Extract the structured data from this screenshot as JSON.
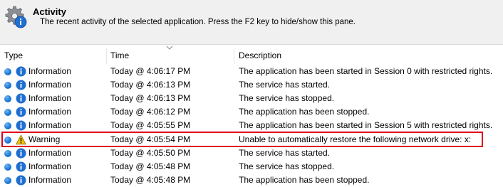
{
  "header": {
    "title": "Activity",
    "subtitle": "The recent activity of the selected application. Press the F2 key to hide/show this pane."
  },
  "columns": {
    "type": "Type",
    "time": "Time",
    "description": "Description"
  },
  "rows": [
    {
      "type": "Information",
      "time": "Today @ 4:06:17 PM",
      "description": "The application has been started in Session 0 with restricted rights.",
      "icon": "info-icon"
    },
    {
      "type": "Information",
      "time": "Today @ 4:06:13 PM",
      "description": "The service has started.",
      "icon": "info-icon"
    },
    {
      "type": "Information",
      "time": "Today @ 4:06:13 PM",
      "description": "The service has stopped.",
      "icon": "info-icon"
    },
    {
      "type": "Information",
      "time": "Today @ 4:06:12 PM",
      "description": "The application has been stopped.",
      "icon": "info-icon"
    },
    {
      "type": "Information",
      "time": "Today @ 4:05:55 PM",
      "description": "The application has been started in Session 5 with restricted rights.",
      "icon": "info-icon"
    },
    {
      "type": "Warning",
      "time": "Today @ 4:05:54 PM",
      "description": "Unable to automatically restore the following network drive: x:",
      "icon": "warning-icon"
    },
    {
      "type": "Information",
      "time": "Today @ 4:05:50 PM",
      "description": "The service has started.",
      "icon": "info-icon"
    },
    {
      "type": "Information",
      "time": "Today @ 4:05:48 PM",
      "description": "The service has stopped.",
      "icon": "info-icon"
    },
    {
      "type": "Information",
      "time": "Today @ 4:05:48 PM",
      "description": "The application has been stopped.",
      "icon": "info-icon"
    }
  ],
  "colors": {
    "highlight": "#e0001b",
    "info_blue": "#1f6fd1",
    "warning_yellow": "#f4c20d"
  }
}
